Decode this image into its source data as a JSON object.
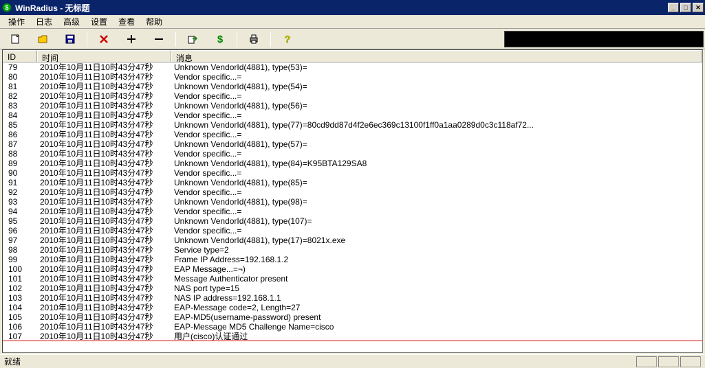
{
  "window": {
    "title": "WinRadius - 无标题"
  },
  "menu": {
    "items": [
      "操作",
      "日志",
      "高级",
      "设置",
      "查看",
      "帮助"
    ]
  },
  "toolbar": {
    "icons": [
      {
        "name": "new-icon",
        "group": 1
      },
      {
        "name": "open-icon",
        "group": 1
      },
      {
        "name": "save-icon",
        "group": 1
      },
      {
        "name": "delete-icon",
        "group": 2
      },
      {
        "name": "add-icon",
        "group": 2
      },
      {
        "name": "remove-icon",
        "group": 2
      },
      {
        "name": "export-icon",
        "group": 3
      },
      {
        "name": "dollar-icon",
        "group": 3
      },
      {
        "name": "print-icon",
        "group": 4
      },
      {
        "name": "help-icon",
        "group": 5
      }
    ]
  },
  "columns": {
    "id": "ID",
    "time": "时间",
    "msg": "消息"
  },
  "rows": [
    {
      "id": "79",
      "time": "2010年10月11日10时43分47秒",
      "msg": "Unknown VendorId(4881), type(53)="
    },
    {
      "id": "80",
      "time": "2010年10月11日10时43分47秒",
      "msg": "Vendor specific...="
    },
    {
      "id": "81",
      "time": "2010年10月11日10时43分47秒",
      "msg": "Unknown VendorId(4881), type(54)="
    },
    {
      "id": "82",
      "time": "2010年10月11日10时43分47秒",
      "msg": "Vendor specific...="
    },
    {
      "id": "83",
      "time": "2010年10月11日10时43分47秒",
      "msg": "Unknown VendorId(4881), type(56)="
    },
    {
      "id": "84",
      "time": "2010年10月11日10时43分47秒",
      "msg": "Vendor specific...="
    },
    {
      "id": "85",
      "time": "2010年10月11日10时43分47秒",
      "msg": "Unknown VendorId(4881), type(77)=80cd9dd87d4f2e6ec369c13100f1ff0a1aa0289d0c3c118af72..."
    },
    {
      "id": "86",
      "time": "2010年10月11日10时43分47秒",
      "msg": "Vendor specific...="
    },
    {
      "id": "87",
      "time": "2010年10月11日10时43分47秒",
      "msg": "Unknown VendorId(4881), type(57)="
    },
    {
      "id": "88",
      "time": "2010年10月11日10时43分47秒",
      "msg": "Vendor specific...="
    },
    {
      "id": "89",
      "time": "2010年10月11日10时43分47秒",
      "msg": "Unknown VendorId(4881), type(84)=K95BTA129SA8"
    },
    {
      "id": "90",
      "time": "2010年10月11日10时43分47秒",
      "msg": "Vendor specific...="
    },
    {
      "id": "91",
      "time": "2010年10月11日10时43分47秒",
      "msg": "Unknown VendorId(4881), type(85)="
    },
    {
      "id": "92",
      "time": "2010年10月11日10时43分47秒",
      "msg": "Vendor specific...="
    },
    {
      "id": "93",
      "time": "2010年10月11日10时43分47秒",
      "msg": "Unknown VendorId(4881), type(98)="
    },
    {
      "id": "94",
      "time": "2010年10月11日10时43分47秒",
      "msg": "Vendor specific...="
    },
    {
      "id": "95",
      "time": "2010年10月11日10时43分47秒",
      "msg": "Unknown VendorId(4881), type(107)="
    },
    {
      "id": "96",
      "time": "2010年10月11日10时43分47秒",
      "msg": "Vendor specific...="
    },
    {
      "id": "97",
      "time": "2010年10月11日10时43分47秒",
      "msg": "Unknown VendorId(4881), type(17)=8021x.exe"
    },
    {
      "id": "98",
      "time": "2010年10月11日10时43分47秒",
      "msg": "Service type=2"
    },
    {
      "id": "99",
      "time": "2010年10月11日10时43分47秒",
      "msg": "Frame IP Address=192.168.1.2"
    },
    {
      "id": "100",
      "time": "2010年10月11日10时43分47秒",
      "msg": "EAP Message...=¬)"
    },
    {
      "id": "101",
      "time": "2010年10月11日10时43分47秒",
      "msg": "Message Authenticator present"
    },
    {
      "id": "102",
      "time": "2010年10月11日10时43分47秒",
      "msg": "NAS port type=15"
    },
    {
      "id": "103",
      "time": "2010年10月11日10时43分47秒",
      "msg": "NAS IP address=192.168.1.1"
    },
    {
      "id": "104",
      "time": "2010年10月11日10时43分47秒",
      "msg": "EAP-Message code=2, Length=27"
    },
    {
      "id": "105",
      "time": "2010年10月11日10时43分47秒",
      "msg": "EAP-MD5(username-password) present"
    },
    {
      "id": "106",
      "time": "2010年10月11日10时43分47秒",
      "msg": "EAP-Message MD5 Challenge Name=cisco"
    },
    {
      "id": "107",
      "time": "2010年10月11日10时43分47秒",
      "msg": "用户(cisco)认证通过",
      "redline": true
    }
  ],
  "status": {
    "text": "就绪"
  }
}
